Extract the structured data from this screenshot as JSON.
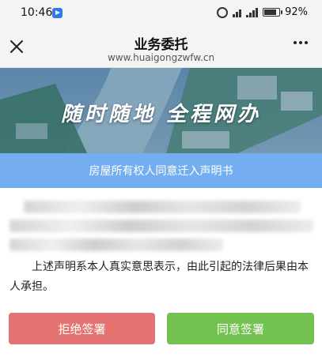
{
  "status_bar": {
    "time": "10:46",
    "battery_pct": "92%"
  },
  "nav": {
    "title": "业务委托",
    "url": "www.huaigongzwfw.cn"
  },
  "banner": {
    "slogan": "随时随地 全程网办"
  },
  "document": {
    "title": "房屋所有权人同意迁入声明书",
    "statement": "上述声明系本人真实意思表示，由此引起的法律后果由本人承担。"
  },
  "buttons": {
    "reject": "拒绝签署",
    "agree": "同意签署"
  },
  "colors": {
    "header_strip": "#74aef1",
    "reject": "#e57373",
    "agree": "#73c151"
  }
}
